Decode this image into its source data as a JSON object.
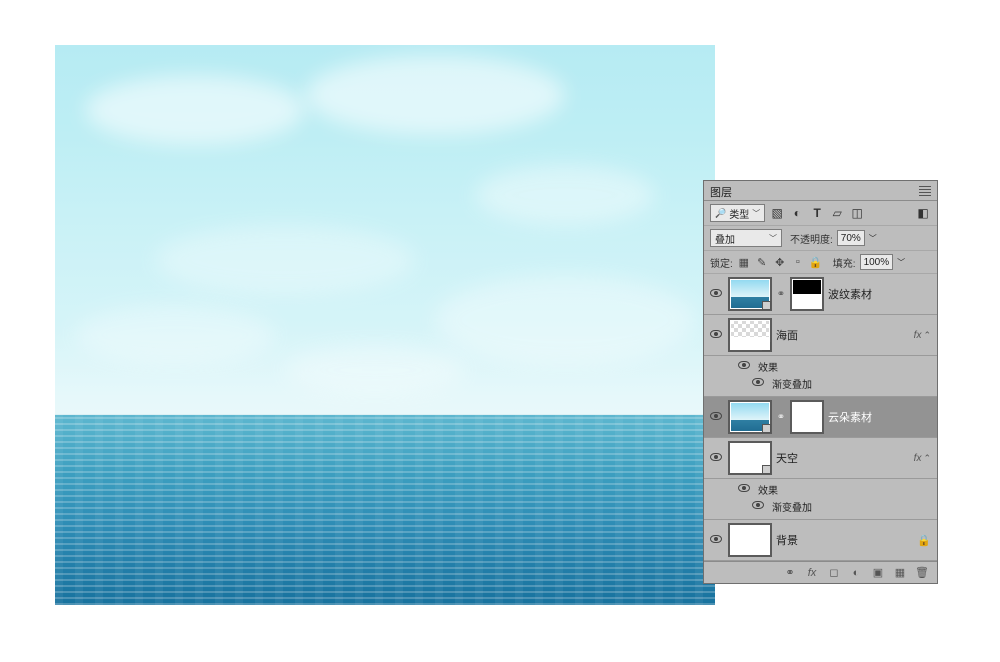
{
  "panel": {
    "title": "图层",
    "filter_label": "类型",
    "search_icon": "search-icon",
    "blend_mode": "叠加",
    "opacity_label": "不透明度:",
    "opacity_value": "70%",
    "lock_label": "锁定:",
    "fill_label": "填充:",
    "fill_value": "100%"
  },
  "layers": [
    {
      "name": "波纹素材",
      "thumb": "sky",
      "mask": "half",
      "fx": false,
      "locked": false
    },
    {
      "name": "海面",
      "thumb": "checker-half",
      "mask": null,
      "fx": true,
      "locked": false,
      "effects": {
        "label": "效果",
        "items": [
          "渐变叠加"
        ]
      }
    },
    {
      "name": "云朵素材",
      "thumb": "sky",
      "mask": "white",
      "fx": false,
      "locked": false,
      "selected": true
    },
    {
      "name": "天空",
      "thumb": "white",
      "mask": null,
      "fx": true,
      "locked": false,
      "effects": {
        "label": "效果",
        "items": [
          "渐变叠加"
        ]
      }
    },
    {
      "name": "背景",
      "thumb": "white",
      "mask": null,
      "fx": false,
      "locked": true
    }
  ],
  "footer_icons": [
    "link",
    "fx",
    "mask",
    "adjust",
    "folder",
    "new",
    "trash"
  ]
}
